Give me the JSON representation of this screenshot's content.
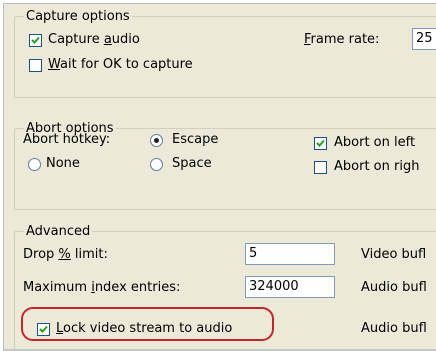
{
  "capture_options": {
    "legend": "Capture options",
    "capture_audio": {
      "label_pre": "Capture ",
      "label_key": "a",
      "label_post": "udio",
      "checked": true
    },
    "wait_for_ok": {
      "label_pre": "",
      "label_key": "W",
      "label_post": "ait for OK to capture",
      "checked": false
    },
    "frame_rate": {
      "label_pre": "",
      "label_key": "F",
      "label_post": "rame rate:",
      "value": "25"
    }
  },
  "abort_options": {
    "legend": "Abort options",
    "hotkey_label": "Abort hotkey:",
    "escape": {
      "label": "Escape",
      "selected": true
    },
    "none": {
      "label": "None",
      "selected": false
    },
    "space": {
      "label": "Space",
      "selected": false
    },
    "abort_left": {
      "label": "Abort on left",
      "checked": true
    },
    "abort_right": {
      "label": "Abort on righ",
      "checked": false
    }
  },
  "advanced": {
    "legend": "Advanced",
    "drop_limit": {
      "label_pre": "Drop ",
      "label_key": "%",
      "label_post": " limit:",
      "value": "5"
    },
    "max_index": {
      "label_pre": "Maximum ",
      "label_key": "i",
      "label_post": "ndex entries:",
      "value": "324000"
    },
    "lock_video": {
      "label_pre": "",
      "label_key": "L",
      "label_post": "ock video stream to audio",
      "checked": true
    },
    "video_buf_label": "Video bufl",
    "audio_buf_label_1": "Audio bufl",
    "audio_buf_label_2": "Audio bufl"
  },
  "accent": {
    "highlight_ring": "#c0272d",
    "checkmark": "#21a121"
  }
}
